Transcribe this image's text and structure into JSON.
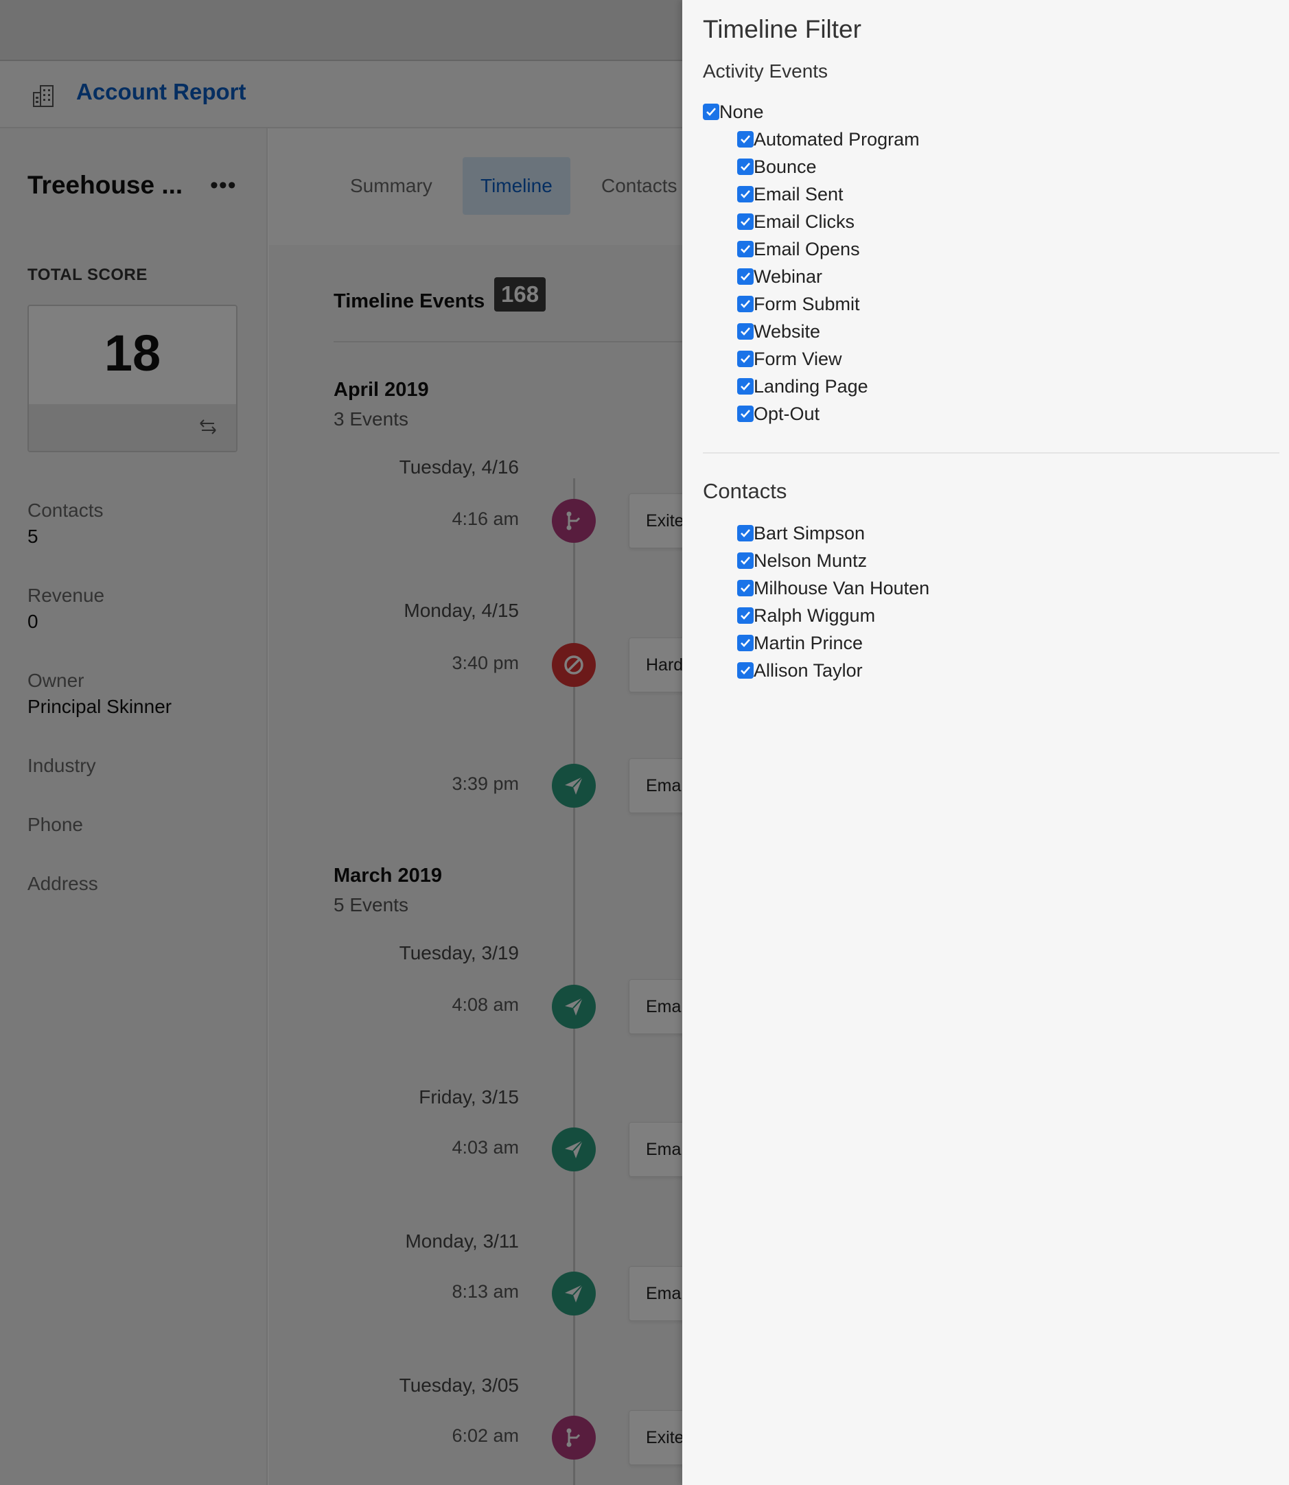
{
  "app": {
    "header_title": "Account Report",
    "icons": {
      "header": "building-icon",
      "more": "more-dots-icon",
      "swap": "swap-arrows-icon"
    }
  },
  "sidebar": {
    "account_name": "Treehouse ...",
    "more_label": "•••",
    "total_score_label": "TOTAL SCORE",
    "total_score": "18",
    "fields": [
      {
        "label": "Contacts",
        "value": "5"
      },
      {
        "label": "Revenue",
        "value": "0"
      },
      {
        "label": "Owner",
        "value": "Principal Skinner"
      },
      {
        "label": "Industry",
        "value": ""
      },
      {
        "label": "Phone",
        "value": ""
      },
      {
        "label": "Address",
        "value": ""
      }
    ]
  },
  "tabs": [
    {
      "label": "Summary",
      "active": false
    },
    {
      "label": "Timeline",
      "active": true
    },
    {
      "label": "Contacts",
      "active": false
    }
  ],
  "timeline": {
    "title": "Timeline Events",
    "count": "168",
    "months": [
      {
        "title": "April 2019",
        "count": "3 Events"
      },
      {
        "title": "March 2019",
        "count": "5 Events"
      }
    ],
    "days": [
      "Tuesday, 4/16",
      "Monday, 4/15",
      "Tuesday, 3/19",
      "Friday, 3/15",
      "Monday, 3/11",
      "Tuesday, 3/05"
    ],
    "events": [
      {
        "time": "4:16 am",
        "icon": "program-exit-icon",
        "color": "#b03a7d",
        "card": "Exite"
      },
      {
        "time": "3:40 pm",
        "icon": "bounce-icon",
        "color": "#d93434",
        "card": "Hard"
      },
      {
        "time": "3:39 pm",
        "icon": "email-sent-icon",
        "color": "#2a9a7c",
        "card": "Emai"
      },
      {
        "time": "4:08 am",
        "icon": "email-sent-icon",
        "color": "#2a9a7c",
        "card": "Emai"
      },
      {
        "time": "4:03 am",
        "icon": "email-sent-icon",
        "color": "#2a9a7c",
        "card": "Emai"
      },
      {
        "time": "8:13 am",
        "icon": "email-sent-icon",
        "color": "#2a9a7c",
        "card": "Emai"
      },
      {
        "time": "6:02 am",
        "icon": "program-exit-icon",
        "color": "#b03a7d",
        "card": "Exite"
      }
    ]
  },
  "filter": {
    "title": "Timeline Filter",
    "activity_label": "Activity Events",
    "none_label": "None",
    "none_checked": true,
    "activity_items": [
      {
        "label": "Automated Program",
        "checked": true
      },
      {
        "label": "Bounce",
        "checked": true
      },
      {
        "label": "Email Sent",
        "checked": true
      },
      {
        "label": "Email Clicks",
        "checked": true
      },
      {
        "label": "Email Opens",
        "checked": true
      },
      {
        "label": "Webinar",
        "checked": true
      },
      {
        "label": "Form Submit",
        "checked": true
      },
      {
        "label": "Website",
        "checked": true
      },
      {
        "label": "Form View",
        "checked": true
      },
      {
        "label": "Landing Page",
        "checked": true
      },
      {
        "label": "Opt-Out",
        "checked": true
      }
    ],
    "contacts_label": "Contacts",
    "contact_items": [
      {
        "label": "Bart Simpson",
        "checked": true
      },
      {
        "label": "Nelson Muntz",
        "checked": true
      },
      {
        "label": "Milhouse Van Houten",
        "checked": true
      },
      {
        "label": "Ralph Wiggum",
        "checked": true
      },
      {
        "label": "Martin Prince",
        "checked": true
      },
      {
        "label": "Allison Taylor",
        "checked": true
      }
    ],
    "checkbox_color": "#1a73e8"
  }
}
